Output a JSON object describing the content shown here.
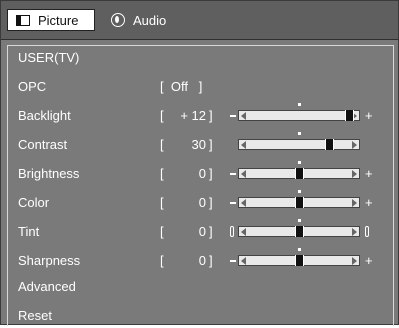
{
  "tabs": [
    {
      "label": "Picture",
      "icon": "picture-icon",
      "active": true
    },
    {
      "label": "Audio",
      "icon": "audio-icon",
      "active": false
    }
  ],
  "mode": "USER(TV)",
  "opc": {
    "label": "OPC",
    "value": "Off"
  },
  "settings": [
    {
      "label": "Backlight",
      "value": "+ 12",
      "level": 0.92,
      "min": -16,
      "max": 16,
      "show_minus": true,
      "show_plus": true,
      "tint": false
    },
    {
      "label": "Contrast",
      "value": "30",
      "level": 0.75,
      "min": 0,
      "max": 40,
      "show_minus": false,
      "show_plus": false,
      "tint": false
    },
    {
      "label": "Brightness",
      "value": "0",
      "level": 0.5,
      "min": -30,
      "max": 30,
      "show_minus": true,
      "show_plus": true,
      "tint": false
    },
    {
      "label": "Color",
      "value": "0",
      "level": 0.5,
      "min": -30,
      "max": 30,
      "show_minus": true,
      "show_plus": true,
      "tint": false
    },
    {
      "label": "Tint",
      "value": "0",
      "level": 0.5,
      "min": -30,
      "max": 30,
      "show_minus": false,
      "show_plus": false,
      "tint": true
    },
    {
      "label": "Sharpness",
      "value": "0",
      "level": 0.5,
      "min": -10,
      "max": 10,
      "show_minus": true,
      "show_plus": true,
      "tint": false
    }
  ],
  "menu_items": [
    "Advanced",
    "Reset"
  ],
  "colors": {
    "frame_bg": "#7a7a7a",
    "tab_bar_bg": "#5f5f5f",
    "track": "#e9e9e9",
    "thumb": "#111111"
  }
}
